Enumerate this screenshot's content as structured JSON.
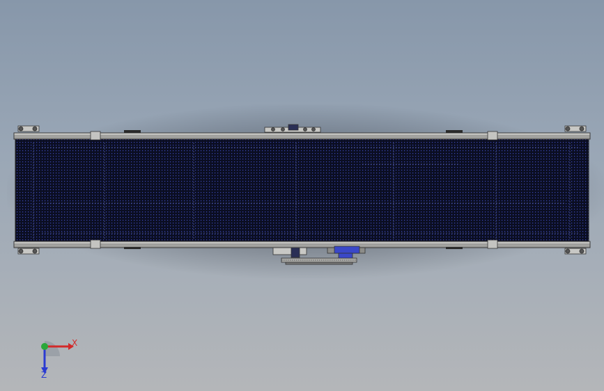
{
  "viewport": {
    "background_top": "#8797aa",
    "background_bottom": "#b4b6b9",
    "model": "belt-conveyor-top-view"
  },
  "model_colors": {
    "frame_rail": "#b9b9b6",
    "frame_edge": "#3b3b3b",
    "belt": "#0b0e22",
    "belt_mesh": "#3b48b8",
    "drive_motor": "#3a48c8"
  },
  "triad": {
    "x_label": "X",
    "z_label": "Z",
    "x_color": "#d22a2a",
    "y_color": "#2aa83a",
    "z_color": "#2a3ad2"
  }
}
